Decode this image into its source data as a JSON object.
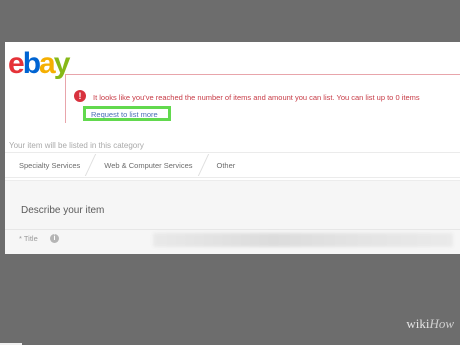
{
  "logo": {
    "letters": [
      "e",
      "b",
      "a",
      "y"
    ],
    "colors": [
      "#e53238",
      "#0064d2",
      "#f5af02",
      "#86b817"
    ]
  },
  "alert": {
    "icon": "!",
    "message": "It looks like you've reached the number of items and amount you can list. You can list up to 0 items",
    "link_label": "Request to list more",
    "highlight_color": "#62d94e"
  },
  "category": {
    "heading": "Your item will be listed in this category",
    "breadcrumbs": [
      "Specialty Services",
      "Web & Computer Services",
      "Other"
    ]
  },
  "describe": {
    "title": "Describe your item",
    "title_label": "* Title",
    "info_icon": "i",
    "title_value": ""
  },
  "watermark": {
    "wiki": "wiki",
    "how": "How"
  }
}
